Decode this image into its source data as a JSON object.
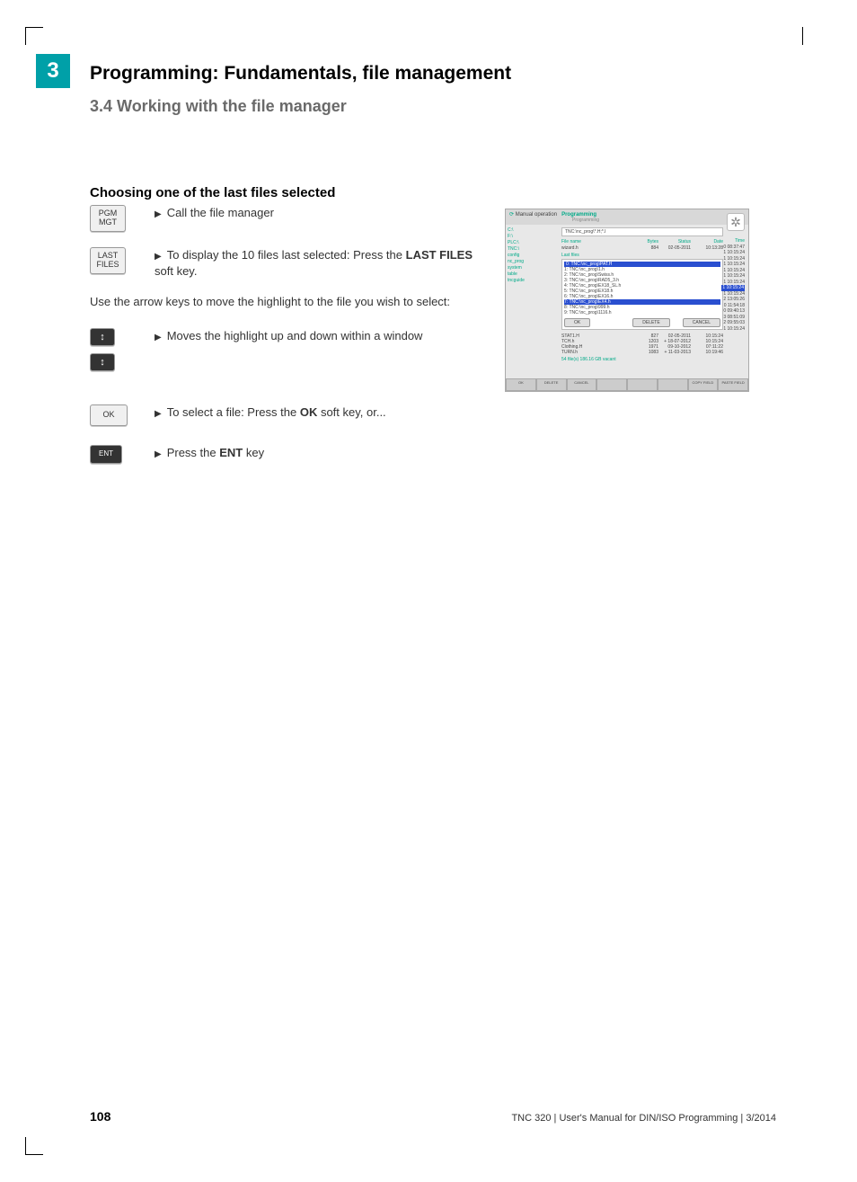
{
  "chapter_number": "3",
  "chapter_title": "Programming: Fundamentals, file management",
  "section_heading": "3.4    Working with the file manager",
  "sub_heading": "Choosing one of the last files selected",
  "keys": {
    "pgm_mgt": "PGM\nMGT",
    "last_files": "LAST\nFILES",
    "arrow": "↕",
    "ok": "OK",
    "ent": "ENT"
  },
  "steps": {
    "s1": "Call the file manager",
    "s2a": "To display the 10 files last selected: Press the ",
    "s2b": "LAST FILES",
    "s2c": " soft key.",
    "body": "Use the arrow keys to move the highlight to the file you wish to select:",
    "s3": "Moves the highlight up and down within a window",
    "s4a": "To select a file: Press the ",
    "s4b": "OK",
    "s4c": " soft key, or...",
    "s5a": "Press the ",
    "s5b": "ENT",
    "s5c": " key"
  },
  "screenshot": {
    "header_left": "Manual operation",
    "header_prog": "Programming",
    "header_sub": "Programming",
    "path": "TNC:\\nc_prog\\*.H;*.I",
    "tree": [
      "C:\\",
      "F:\\",
      "PLC:\\",
      "TNC:\\",
      "  config",
      "  nc_prog",
      "  system",
      "  table",
      "  tncguide"
    ],
    "col_filename": "File name",
    "col_bytes": "Bytes",
    "col_status": "Status",
    "col_date": "Date",
    "col_time": "Time",
    "filerow": {
      "name": "wizard.h",
      "bytes": "884",
      "date": "02-05-2011",
      "time": "10:13:28"
    },
    "last_title": "Last files",
    "last_head": "0: TNC:\\nc_prog\\PAT.H",
    "last_files": [
      "1: TNC:\\nc_prog\\1.h",
      "2: TNC:\\nc_prog\\Swiss.h",
      "3: TNC:\\nc_prog\\RAD5_3.h",
      "4: TNC:\\nc_prog\\EX18_SL.h",
      "5: TNC:\\nc_prog\\EX18.h",
      "6: TNC:\\nc_prog\\EX16.h",
      "7: TNC:\\nc_prog\\EX4.h",
      "8: TNC:\\nc_prog\\999.h",
      "9: TNC:\\nc_prog\\1116.h"
    ],
    "times": [
      "0 08:37:47",
      "1 10:15:24",
      "1 10:15:24",
      "1 10:15:24",
      "1 10:15:24",
      "1 10:15:24",
      "1 10:15:24",
      "1 10:15:24",
      "1 10:15:24",
      "2 13:05:26",
      "0 11:54:18",
      "0 09:40:13",
      "3 08:51:09",
      "2 09:55:03",
      "1 10:15:24"
    ],
    "btn_ok": "OK",
    "btn_delete": "DELETE",
    "btn_cancel": "CANCEL",
    "lower_rows": [
      {
        "name": "STAT1.H",
        "bytes": "827",
        "date": "02-05-2011",
        "time": "10:15:24"
      },
      {
        "name": "TCH.h",
        "bytes": "1203",
        "date": "+ 18-07-2012",
        "time": "10:15:24"
      },
      {
        "name": "Clothing.H",
        "bytes": "1971",
        "date": "09-10-2012",
        "time": "07:11:22"
      },
      {
        "name": "TURN.h",
        "bytes": "1083",
        "date": "+ 11-03-2013",
        "time": "10:19:46"
      }
    ],
    "summary": "54 file(s) 186.16 GB vacant",
    "softkeys": [
      "OK",
      "DELETE",
      "CANCEL",
      "",
      "",
      "",
      "COPY FIELD",
      "PASTE FIELD"
    ]
  },
  "page_number": "108",
  "footer": "TNC 320 | User's Manual for DIN/ISO Programming | 3/2014"
}
